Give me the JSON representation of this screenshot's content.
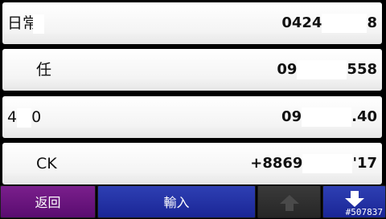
{
  "contacts": [
    {
      "name": "日常",
      "number": "0424",
      "number_end": "8"
    },
    {
      "name": "任",
      "number": "09",
      "number_end": "558"
    },
    {
      "name": "4",
      "name_end": "0",
      "number": "09",
      "number_end": ".40"
    },
    {
      "name": "CK",
      "number": "+8869",
      "number_end": "'17"
    }
  ],
  "toolbar": {
    "back_label": "返回",
    "input_label": "輸入",
    "up_icon": "arrow-up-icon",
    "down_icon": "arrow-down-icon"
  },
  "image_tag": "#507837"
}
